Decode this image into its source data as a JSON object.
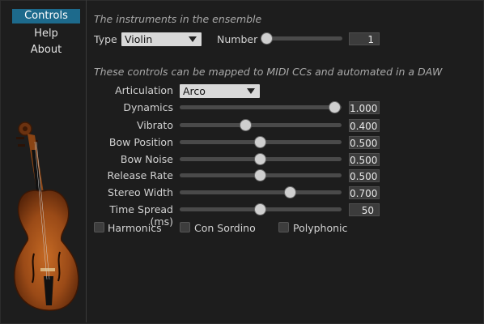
{
  "nav": {
    "items": [
      "Controls",
      "Help",
      "About"
    ],
    "active": "Controls"
  },
  "ensemble": {
    "heading": "The instruments in the ensemble",
    "type_label": "Type",
    "type_value": "Violin",
    "number_label": "Number",
    "number_value": "1",
    "number_fraction": 0.0
  },
  "midi": {
    "heading": "These controls can be mapped to MIDI CCs and automated in a DAW",
    "articulation_label": "Articulation",
    "articulation_value": "Arco",
    "sliders": [
      {
        "label": "Dynamics",
        "value": "1.000",
        "fraction": 1.0
      },
      {
        "label": "Vibrato",
        "value": "0.400",
        "fraction": 0.4
      },
      {
        "label": "Bow Position",
        "value": "0.500",
        "fraction": 0.5
      },
      {
        "label": "Bow Noise",
        "value": "0.500",
        "fraction": 0.5
      },
      {
        "label": "Release Rate",
        "value": "0.500",
        "fraction": 0.5
      },
      {
        "label": "Stereo Width",
        "value": "0.700",
        "fraction": 0.7
      },
      {
        "label": "Time Spread (ms)",
        "value": "50",
        "fraction": 0.5
      }
    ],
    "checkboxes": [
      {
        "label": "Harmonics",
        "checked": false
      },
      {
        "label": "Con Sordino",
        "checked": false
      },
      {
        "label": "Polyphonic",
        "checked": false
      }
    ]
  },
  "colors": {
    "accent": "#1d6a8c",
    "background": "#1d1d1d"
  }
}
